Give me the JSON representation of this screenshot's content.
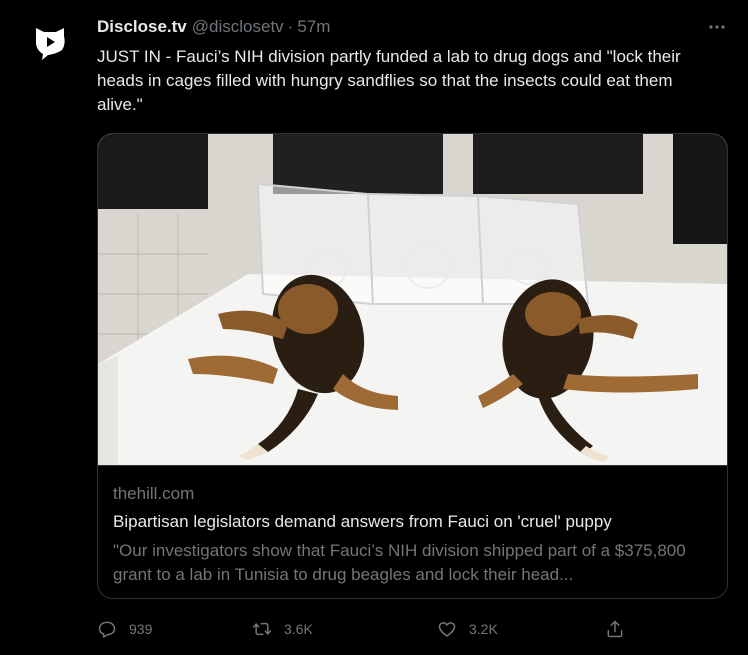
{
  "colors": {
    "background": "#000000",
    "text_primary": "#e7e9ea",
    "text_secondary": "#71767b",
    "border": "#2f3336"
  },
  "tweet": {
    "display_name": "Disclose.tv",
    "handle": "@disclosetv",
    "separator": "·",
    "time": "57m",
    "avatar_icon": "disclose-tv-logo",
    "more_icon": "ellipsis-icon",
    "text": "JUST IN - Fauci’s NIH division partly funded a lab to drug dogs and \"lock their heads in cages filled with hungry sandflies so that the insects could eat them alive.\""
  },
  "card": {
    "domain": "thehill.com",
    "title": "Bipartisan legislators demand answers from Fauci on 'cruel' puppy",
    "description": "\"Our investigators show that Fauci’s NIH division shipped part of a $375,800 grant to a lab in Tunisia to drug beagles and lock their head..."
  },
  "actions": {
    "reply": {
      "icon": "reply-icon",
      "count": "939"
    },
    "retweet": {
      "icon": "retweet-icon",
      "count": "3.6K"
    },
    "like": {
      "icon": "heart-icon",
      "count": "3.2K"
    },
    "share": {
      "icon": "share-icon"
    }
  }
}
